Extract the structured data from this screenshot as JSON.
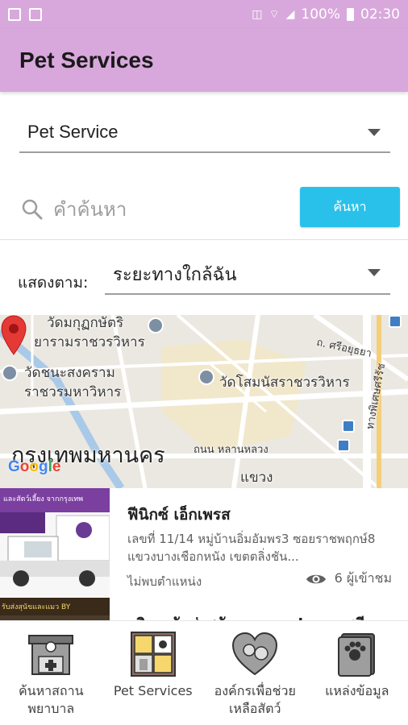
{
  "status_bar": {
    "battery": "100%",
    "time": "02:30"
  },
  "app_bar": {
    "title": "Pet Services"
  },
  "category_dropdown": {
    "selected": "Pet Service"
  },
  "search": {
    "placeholder": "คำค้นหา",
    "button_label": "ค้นหา"
  },
  "sort": {
    "label": "แสดงตาม:",
    "selected": "ระยะทางใกล้ฉัน"
  },
  "map": {
    "labels": {
      "temple1_line1": "วัดมกุฏกษัตริ",
      "temple1_line2": "ยารามราชวรวิหาร",
      "temple2_line1": "วัดชนะสงคราม",
      "temple2_line2": "ราชวรมหาวิหาร",
      "temple3": "วัดโสมนัสราชวรวิหาร",
      "road1": "ถ. ศรีอยุธยา",
      "road2": "ถนน หลานหลวง",
      "road3": "ทางพิเศษศรีรัช",
      "city": "กรุงเทพมหานคร",
      "district": "แขวง",
      "google": "Google"
    },
    "google_colors": [
      "#4285F4",
      "#EA4335",
      "#FBBC05",
      "#4285F4",
      "#34A853",
      "#EA4335"
    ]
  },
  "results": [
    {
      "title": "ฟีนิกซ์ เอ็กเพรส",
      "address": "เลขที่ 11/14 หมู่บ้านอิ่มอัมพร3 ซอยราชพฤกษ์8 แขวงบางเชือกหนัง เขตตลิ่งชัน...",
      "location": "ไม่พบตำแหน่ง",
      "views": "6 ผู้เข้าชม",
      "thumb_banner": "และสัตว์เลี้ยง จากกรุงเทพ"
    },
    {
      "title": "บริการรับส่งสุนัขและแมว by ตุมชดี",
      "thumb_banner": "รับส่งสุนัขและแมว BY"
    }
  ],
  "bottom_nav": [
    {
      "label": "ค้นหาสถานพยาบาล",
      "icon": "hospital-icon"
    },
    {
      "label": "Pet Services",
      "icon": "pet-shop-icon"
    },
    {
      "label": "องค์กรเพื่อช่วยเหลือสัตว์",
      "icon": "heart-pet-icon"
    },
    {
      "label": "แหล่งข้อมูล",
      "icon": "paw-book-icon"
    }
  ]
}
